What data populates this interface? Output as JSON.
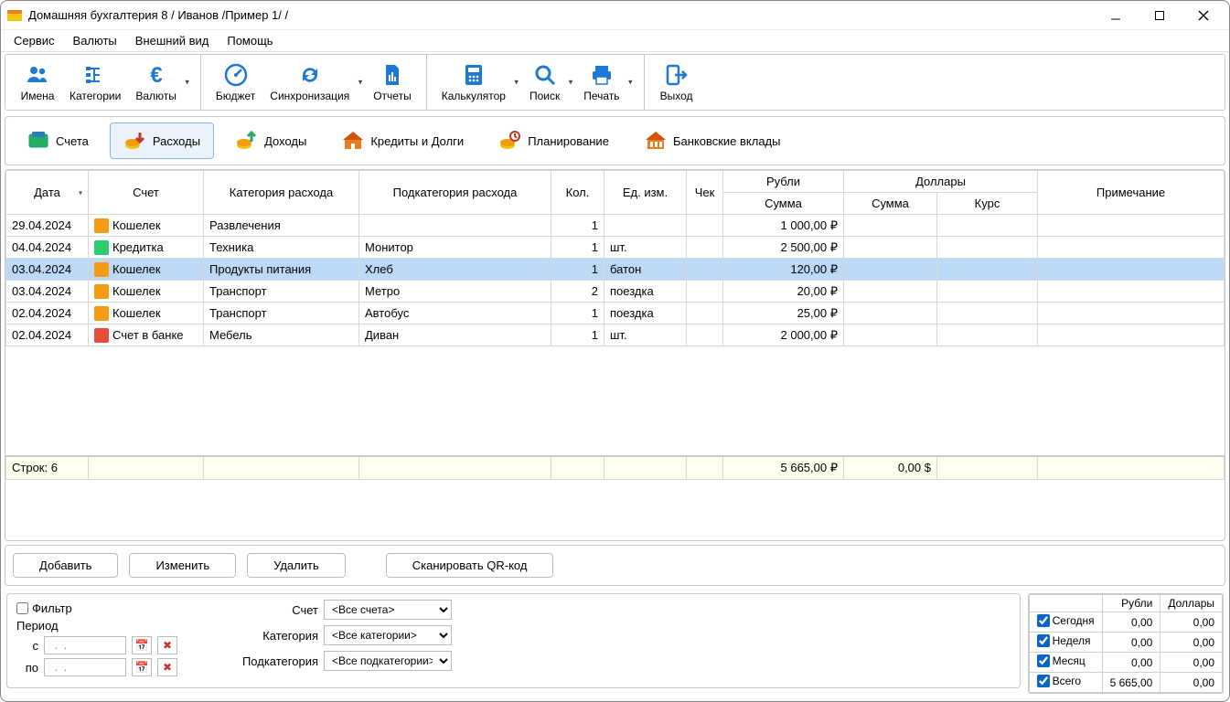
{
  "title": "Домашняя бухгалтерия 8  / Иванов /Пример 1/ /",
  "menubar": [
    "Сервис",
    "Валюты",
    "Внешний вид",
    "Помощь"
  ],
  "toolbar": {
    "groups": [
      [
        {
          "id": "names",
          "label": "Имена",
          "glyph": "people"
        },
        {
          "id": "categories",
          "label": "Категории",
          "glyph": "tree"
        },
        {
          "id": "currencies",
          "label": "Валюты",
          "glyph": "euro",
          "dropdown": true
        }
      ],
      [
        {
          "id": "budget",
          "label": "Бюджет",
          "glyph": "gauge"
        },
        {
          "id": "sync",
          "label": "Синхронизация",
          "glyph": "sync",
          "dropdown": true
        },
        {
          "id": "reports",
          "label": "Отчеты",
          "glyph": "file"
        }
      ],
      [
        {
          "id": "calc",
          "label": "Калькулятор",
          "glyph": "calc",
          "dropdown": true
        },
        {
          "id": "search",
          "label": "Поиск",
          "glyph": "search",
          "dropdown": true
        },
        {
          "id": "print",
          "label": "Печать",
          "glyph": "print",
          "dropdown": true
        }
      ],
      [
        {
          "id": "exit",
          "label": "Выход",
          "glyph": "exit"
        }
      ]
    ]
  },
  "sections": [
    {
      "id": "accounts",
      "label": "Счета",
      "glyph": "accounts"
    },
    {
      "id": "expenses",
      "label": "Расходы",
      "glyph": "expenses",
      "active": true
    },
    {
      "id": "income",
      "label": "Доходы",
      "glyph": "income"
    },
    {
      "id": "debts",
      "label": "Кредиты и Долги",
      "glyph": "debts"
    },
    {
      "id": "planning",
      "label": "Планирование",
      "glyph": "planning"
    },
    {
      "id": "deposits",
      "label": "Банковские вклады",
      "glyph": "deposits"
    }
  ],
  "columns": {
    "date": "Дата",
    "account": "Счет",
    "category": "Категория расхода",
    "subcategory": "Подкатегория расхода",
    "qty": "Кол.",
    "unit": "Ед. изм.",
    "receipt": "Чек",
    "rub": "Рубли",
    "rub_sum": "Сумма",
    "usd": "Доллары",
    "usd_sum": "Сумма",
    "usd_rate": "Курс",
    "note": "Примечание"
  },
  "rows": [
    {
      "date": "29.04.2024",
      "acct": "Кошелек",
      "acct_type": "wallet",
      "cat": "Развлечения",
      "sub": "",
      "qty": "1",
      "unit": "",
      "chk": "",
      "rub": "1 000,00 ₽",
      "usd": "",
      "rate": "",
      "sel": false
    },
    {
      "date": "04.04.2024",
      "acct": "Кредитка",
      "acct_type": "card",
      "cat": "Техника",
      "sub": "Монитор",
      "qty": "1",
      "unit": "шт.",
      "chk": "",
      "rub": "2 500,00 ₽",
      "usd": "",
      "rate": "",
      "sel": false
    },
    {
      "date": "03.04.2024",
      "acct": "Кошелек",
      "acct_type": "wallet",
      "cat": "Продукты питания",
      "sub": "Хлеб",
      "qty": "1",
      "unit": "батон",
      "chk": "",
      "rub": "120,00 ₽",
      "usd": "",
      "rate": "",
      "sel": true
    },
    {
      "date": "03.04.2024",
      "acct": "Кошелек",
      "acct_type": "wallet",
      "cat": "Транспорт",
      "sub": "Метро",
      "qty": "2",
      "unit": "поездка",
      "chk": "",
      "rub": "20,00 ₽",
      "usd": "",
      "rate": "",
      "sel": false
    },
    {
      "date": "02.04.2024",
      "acct": "Кошелек",
      "acct_type": "wallet",
      "cat": "Транспорт",
      "sub": "Автобус",
      "qty": "1",
      "unit": "поездка",
      "chk": "",
      "rub": "25,00 ₽",
      "usd": "",
      "rate": "",
      "sel": false
    },
    {
      "date": "02.04.2024",
      "acct": "Счет в банке",
      "acct_type": "bank",
      "cat": "Мебель",
      "sub": "Диван",
      "qty": "1",
      "unit": "шт.",
      "chk": "",
      "rub": "2 000,00 ₽",
      "usd": "",
      "rate": "",
      "sel": false
    }
  ],
  "totals": {
    "rows_label": "Строк: 6",
    "rub": "5 665,00 ₽",
    "usd": "0,00 $"
  },
  "actions": {
    "add": "Добавить",
    "edit": "Изменить",
    "delete": "Удалить",
    "scan": "Сканировать QR-код"
  },
  "filter": {
    "checkbox_label": "Фильтр",
    "period_label": "Период",
    "from_label": "с",
    "to_label": "по",
    "date_placeholder": "  .  .    ",
    "account_label": "Счет",
    "account_value": "<Все счета>",
    "category_label": "Категория",
    "category_value": "<Все категории>",
    "subcategory_label": "Подкатегория",
    "subcategory_value": "<Все подкатегории>"
  },
  "summary": {
    "col_rub": "Рубли",
    "col_usd": "Доллары",
    "rows": [
      {
        "label": "Сегодня",
        "rub": "0,00",
        "usd": "0,00"
      },
      {
        "label": "Неделя",
        "rub": "0,00",
        "usd": "0,00"
      },
      {
        "label": "Месяц",
        "rub": "0,00",
        "usd": "0,00"
      },
      {
        "label": "Всего",
        "rub": "5 665,00",
        "usd": "0,00"
      }
    ]
  }
}
